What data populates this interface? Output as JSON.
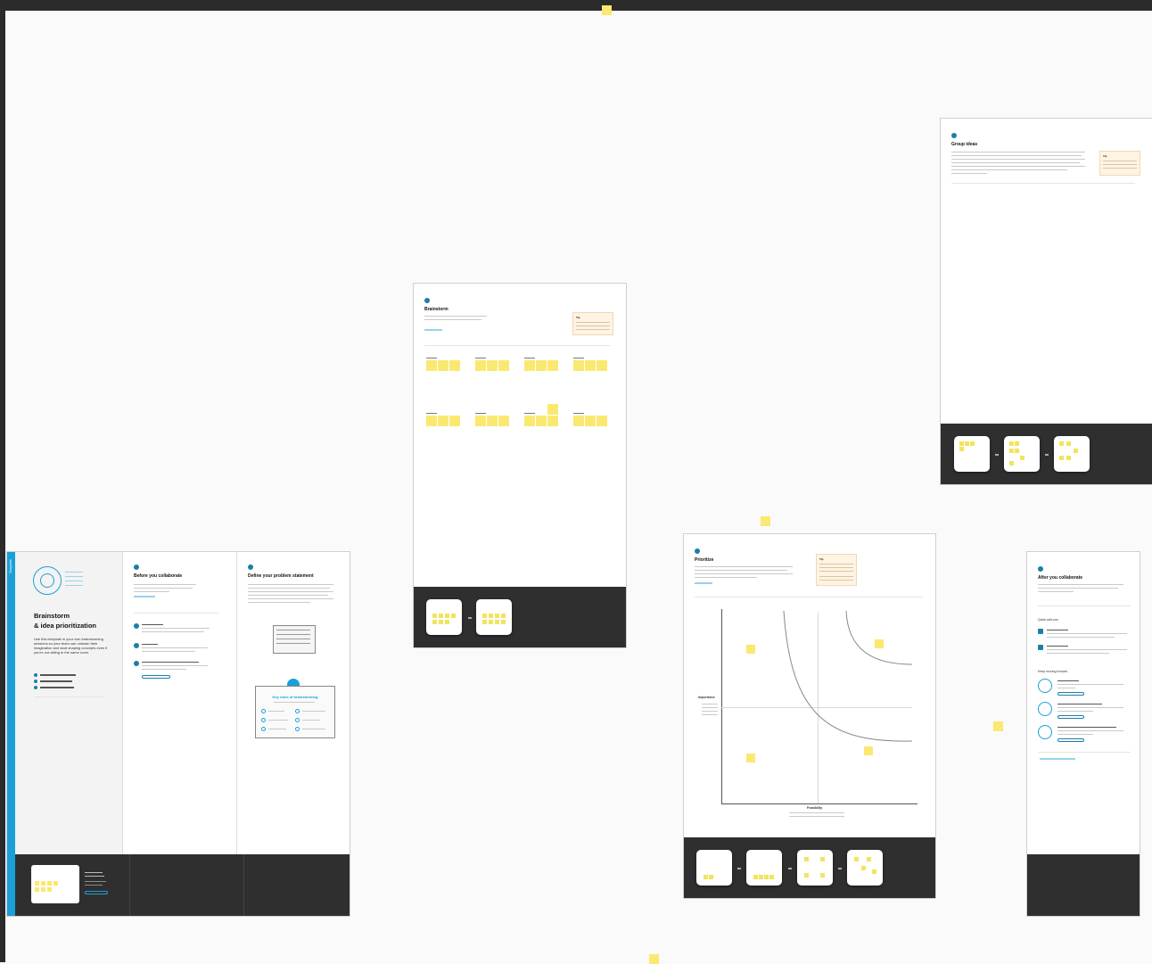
{
  "intro": {
    "side_tab": "Template",
    "title_line1": "Brainstorm",
    "title_line2": "& idea prioritization",
    "description": "Use this template in your own brainstorming sessions so your team can unleash their imagination and start shaping concepts even if you're not sitting in the same room."
  },
  "before": {
    "title": "Before you collaborate"
  },
  "problem": {
    "title": "Define your problem statement",
    "card_title": "Key rules of brainstorming"
  },
  "brainstorm": {
    "title": "Brainstorm",
    "tip_label": "Tip"
  },
  "group": {
    "title": "Group ideas",
    "tip_label": "Tip"
  },
  "prioritize": {
    "title": "Prioritize",
    "tip_label": "Tip",
    "y_label": "Importance",
    "x_label": "Feasibility"
  },
  "after": {
    "title": "After you collaborate",
    "section1": "Quick add-ons",
    "section2": "Keep moving forward"
  },
  "colors": {
    "accent": "#1aa0d8",
    "sticky": "#fbe870",
    "dark_band": "#2f2f2f"
  }
}
